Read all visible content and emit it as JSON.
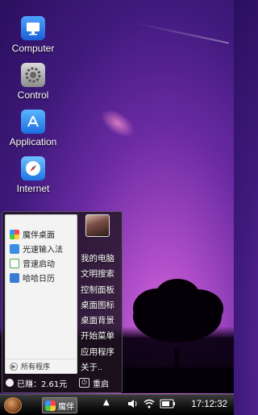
{
  "desktop": {
    "icons": [
      {
        "label": "Computer",
        "icon": "computer-icon"
      },
      {
        "label": "Control",
        "icon": "settings-icon"
      },
      {
        "label": "Application",
        "icon": "app-store-icon"
      },
      {
        "label": "Internet",
        "icon": "compass-icon"
      }
    ]
  },
  "start_menu": {
    "programs": [
      {
        "label": "魔伴桌面",
        "icon": "mobanzhuomian-icon",
        "color": "#e9c640"
      },
      {
        "label": "光速输入法",
        "icon": "guangsu-input-icon",
        "color": "#3a8ee6"
      },
      {
        "label": "音速启动",
        "icon": "yinsu-launch-icon",
        "color": "#4aa84a"
      },
      {
        "label": "哈哈日历",
        "icon": "calendar-icon",
        "color": "#3a7bd5"
      }
    ],
    "all_programs_label": "所有程序",
    "right_items": [
      "我的电脑",
      "文明搜索",
      "控制面板",
      "桌面图标",
      "桌面背景",
      "开始菜单",
      "应用程序",
      "关于.."
    ],
    "earned_label": "已赚：2.61元",
    "restart_label": "重启"
  },
  "taskbar": {
    "task_label": "魔伴",
    "clock": "17:12:32"
  }
}
